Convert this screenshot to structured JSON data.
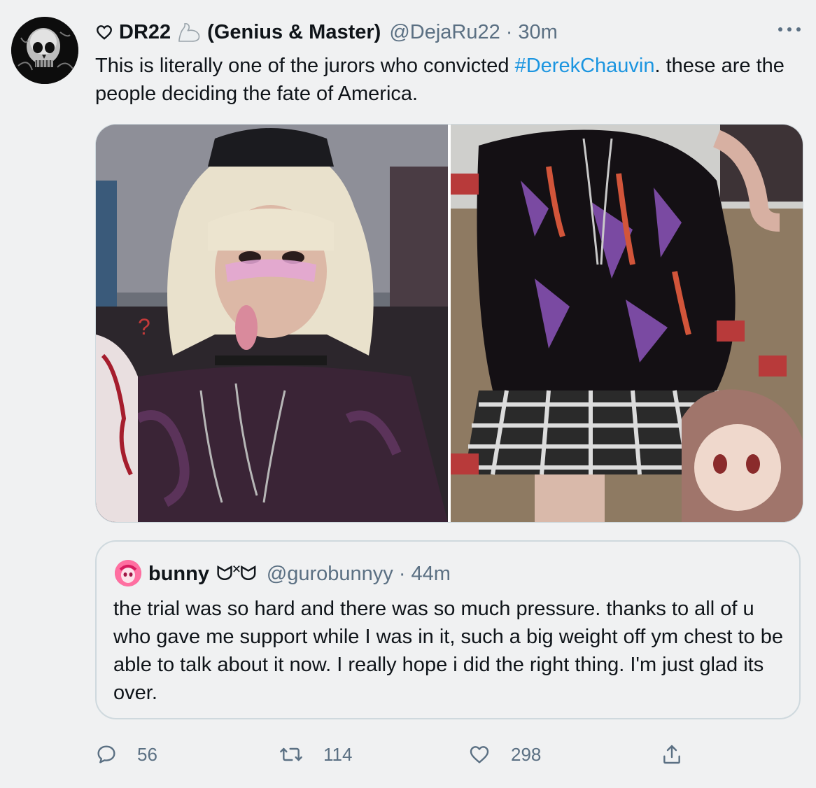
{
  "tweet": {
    "display_name": "DR22",
    "flex_emoji": "flexed-biceps-emoji",
    "name_suffix": "(Genius & Master)",
    "handle": "@DejaRu22",
    "separator": "·",
    "time": "30m",
    "text_before": "This is literally one of the jurors who convicted ",
    "hashtag": "#DerekChauvin",
    "text_after": ". these are the people deciding the fate of America."
  },
  "quote": {
    "display_name": "bunny",
    "emoticon": "ᗢ˟ᗢ",
    "handle": "@gurobunnyy",
    "separator": "·",
    "time": "44m",
    "text": "the trial was so hard and there was so much pressure. thanks to all of u who gave me support while I was in it, such a big weight off ym chest to be able to talk about it now. I really hope i did the right thing. I'm just glad its over."
  },
  "actions": {
    "reply_count": "56",
    "retweet_count": "114",
    "like_count": "298"
  },
  "colors": {
    "background": "#f0f1f2",
    "text": "#0f1419",
    "secondary": "#5b7083",
    "link": "#1b95e0",
    "border": "#cfd9de"
  },
  "icons": {
    "heart_prefix": "heart-outline-icon",
    "more": "more-horizontal-icon",
    "reply": "reply-bubble-icon",
    "retweet": "retweet-icon",
    "like": "heart-icon",
    "share": "share-upload-icon"
  }
}
